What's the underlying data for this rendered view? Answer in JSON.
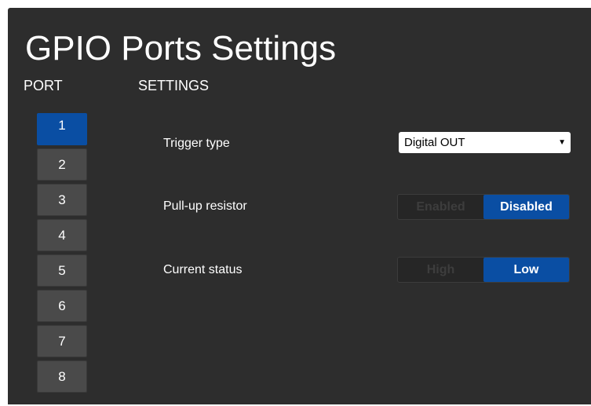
{
  "title": "GPIO Ports Settings",
  "headers": {
    "port": "PORT",
    "settings": "SETTINGS"
  },
  "ports": [
    {
      "label": "1",
      "active": true
    },
    {
      "label": "2",
      "active": false
    },
    {
      "label": "3",
      "active": false
    },
    {
      "label": "4",
      "active": false
    },
    {
      "label": "5",
      "active": false
    },
    {
      "label": "6",
      "active": false
    },
    {
      "label": "7",
      "active": false
    },
    {
      "label": "8",
      "active": false
    }
  ],
  "settings": {
    "trigger_type": {
      "label": "Trigger type",
      "value": "Digital OUT",
      "arrow": "▼"
    },
    "pull_up": {
      "label": "Pull-up resistor",
      "options": [
        "Enabled",
        "Disabled"
      ],
      "selected": "Disabled"
    },
    "current_status": {
      "label": "Current status",
      "options": [
        "High",
        "Low"
      ],
      "selected": "Low"
    }
  },
  "colors": {
    "panel_bg": "#2d2d2d",
    "accent": "#0a4ea3",
    "button_bg": "#4a4a4a",
    "inactive_text": "#3d3d3d"
  }
}
